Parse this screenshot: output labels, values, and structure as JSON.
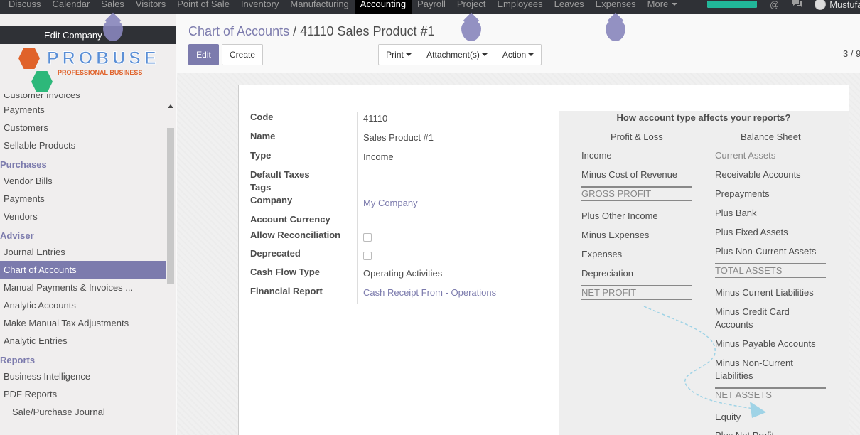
{
  "topbar": {
    "menu": [
      {
        "label": "Discuss",
        "active": false
      },
      {
        "label": "Calendar",
        "active": false
      },
      {
        "label": "Sales",
        "active": false
      },
      {
        "label": "Visitors",
        "active": false
      },
      {
        "label": "Point of Sale",
        "active": false
      },
      {
        "label": "Inventory",
        "active": false
      },
      {
        "label": "Manufacturing",
        "active": false
      },
      {
        "label": "Accounting",
        "active": true
      },
      {
        "label": "Payroll",
        "active": false
      },
      {
        "label": "Project",
        "active": false
      },
      {
        "label": "Employees",
        "active": false
      },
      {
        "label": "Leaves",
        "active": false
      },
      {
        "label": "Expenses",
        "active": false
      },
      {
        "label": "More",
        "active": false,
        "dropdown": true
      }
    ],
    "progress": 1.0,
    "at_icon": "@",
    "chat_icon": "chat-icon",
    "user_name": "Mustufa"
  },
  "sidebar": {
    "company_bar": "Edit Company",
    "logo": {
      "title": "PROBUSE",
      "subtitle": "PROFESSIONAL BUSINESS"
    },
    "items": [
      {
        "type": "item",
        "label": "Customer Invoices",
        "cut": true
      },
      {
        "type": "item",
        "label": "Payments"
      },
      {
        "type": "item",
        "label": "Customers"
      },
      {
        "type": "item",
        "label": "Sellable Products"
      },
      {
        "type": "head",
        "label": "Purchases"
      },
      {
        "type": "item",
        "label": "Vendor Bills"
      },
      {
        "type": "item",
        "label": "Payments"
      },
      {
        "type": "item",
        "label": "Vendors"
      },
      {
        "type": "head",
        "label": "Adviser"
      },
      {
        "type": "item",
        "label": "Journal Entries"
      },
      {
        "type": "item",
        "label": "Chart of Accounts",
        "active": true
      },
      {
        "type": "item",
        "label": "Manual Payments & Invoices ..."
      },
      {
        "type": "item",
        "label": "Analytic Accounts"
      },
      {
        "type": "item",
        "label": "Make Manual Tax Adjustments"
      },
      {
        "type": "item",
        "label": "Analytic Entries"
      },
      {
        "type": "head",
        "label": "Reports"
      },
      {
        "type": "item",
        "label": "Business Intelligence"
      },
      {
        "type": "item",
        "label": "PDF Reports"
      },
      {
        "type": "item",
        "label": "Sale/Purchase Journal",
        "sub": true
      }
    ]
  },
  "header": {
    "breadcrumb_parent": "Chart of Accounts",
    "breadcrumb_sep": " / ",
    "breadcrumb_current": "41110 Sales Product #1",
    "edit": "Edit",
    "create": "Create",
    "print": "Print",
    "attachments": "Attachment(s)",
    "action": "Action",
    "pager": "3 / 9"
  },
  "form": {
    "fields": [
      {
        "label": "Code",
        "value": "41110"
      },
      {
        "label": "Name",
        "value": "Sales Product #1"
      },
      {
        "label": "Type",
        "value": "Income"
      },
      {
        "label": "Default Taxes",
        "value": ""
      },
      {
        "label": "Tags",
        "value": ""
      },
      {
        "label": "Company",
        "value": "My Company",
        "link": true
      },
      {
        "label": "Account Currency",
        "value": ""
      },
      {
        "label": "Allow Reconciliation",
        "checkbox": true,
        "checked": false
      },
      {
        "label": "Deprecated",
        "checkbox": true,
        "checked": false
      },
      {
        "label": "Cash Flow Type",
        "value": "Operating Activities"
      },
      {
        "label": "Financial Report",
        "value": "Cash Receipt From - Operations",
        "link": true
      }
    ]
  },
  "help": {
    "title": "How account type affects your reports?",
    "pl_head": "Profit & Loss",
    "bs_head": "Balance Sheet",
    "pl_items": [
      "Income",
      "Minus Cost of Revenue",
      "GROSS PROFIT",
      "Plus Other Income",
      "Minus Expenses",
      "Expenses",
      "Depreciation",
      "NET PROFIT"
    ],
    "bs_items": [
      "Current Assets",
      "Receivable Accounts",
      "Prepayments",
      "Plus Bank",
      "Plus Fixed Assets",
      "Plus Non-Current Assets",
      "TOTAL ASSETS",
      "Minus Current Liabilities",
      "Minus Credit Card Accounts",
      "Minus Payable Accounts",
      "Minus Non-Current Liabilities",
      "NET ASSETS",
      "Equity",
      "Plus Net Profit"
    ]
  },
  "colors": {
    "primary": "#7c7bad",
    "topbar": "#2f3136",
    "arrow": "#9fd3e6"
  }
}
